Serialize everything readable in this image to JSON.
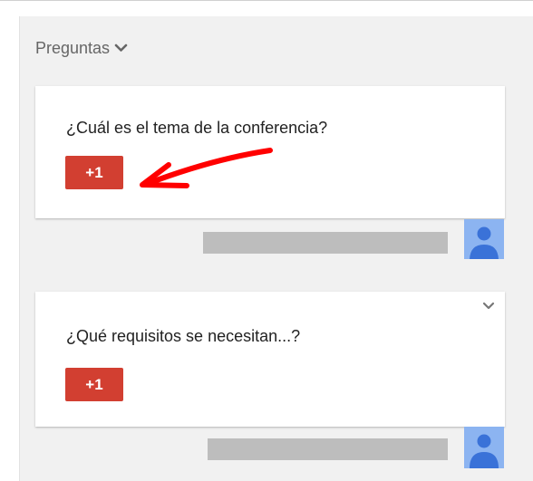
{
  "panel": {
    "title": "Preguntas",
    "title_icon": "chevron-down-icon"
  },
  "questions": [
    {
      "text": "¿Cuál es el tema de la conferencia?",
      "vote_label": "+1",
      "has_menu": false
    },
    {
      "text": "¿Qué requisitos se necesitan...?",
      "vote_label": "+1",
      "has_menu": true,
      "menu_icon": "chevron-down-icon"
    }
  ],
  "annotation": {
    "type": "red-arrow",
    "points_to": "+1 button of first question",
    "color": "#ff0000"
  },
  "colors": {
    "vote_button": "#d23f31",
    "panel_background": "#f1f1f1",
    "card_background": "#ffffff",
    "author_placeholder": "#bdbdbd",
    "avatar_background": "#8cb4f1",
    "avatar_figure": "#3a72d8"
  },
  "avatar_icon": "person-icon"
}
